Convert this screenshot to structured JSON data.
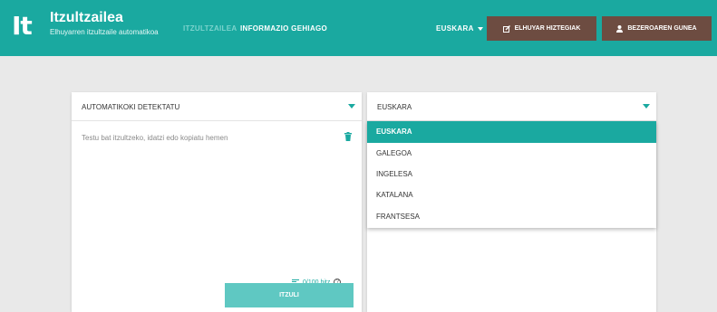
{
  "header": {
    "logo": "It",
    "title": "Itzultzailea",
    "subtitle": "Elhuyarren itzultzaile automatikoa",
    "nav": [
      "ITZULTZAILEA",
      "INFORMAZIO GEHIAGO"
    ],
    "lang_menu": "EUSKARA",
    "dict_button": "ELHUYAR HIZTEGIAK",
    "user_button": "BEZEROAREN GUNEA"
  },
  "source": {
    "selector": "AUTOMATIKOKI DETEKTATU",
    "placeholder": "Testu bat itzultzeko, idatzi edo kopiatu hemen",
    "counter": "0/100 hitz",
    "translate_button": "ITZULI"
  },
  "target": {
    "selector": "EUSKARA",
    "options": [
      "EUSKARA",
      "GALEGOA",
      "INGELESA",
      "KATALANA",
      "FRANTSESA"
    ],
    "selected": "EUSKARA"
  },
  "colors": {
    "accent": "#1aa9a0",
    "brand_button": "#6d4c41",
    "background": "#e9e9e9"
  },
  "icons": {
    "dict": "edit-box-icon",
    "user": "user-icon",
    "trash": "trash-icon",
    "lines": "text-lines-icon",
    "help": "help-icon"
  }
}
